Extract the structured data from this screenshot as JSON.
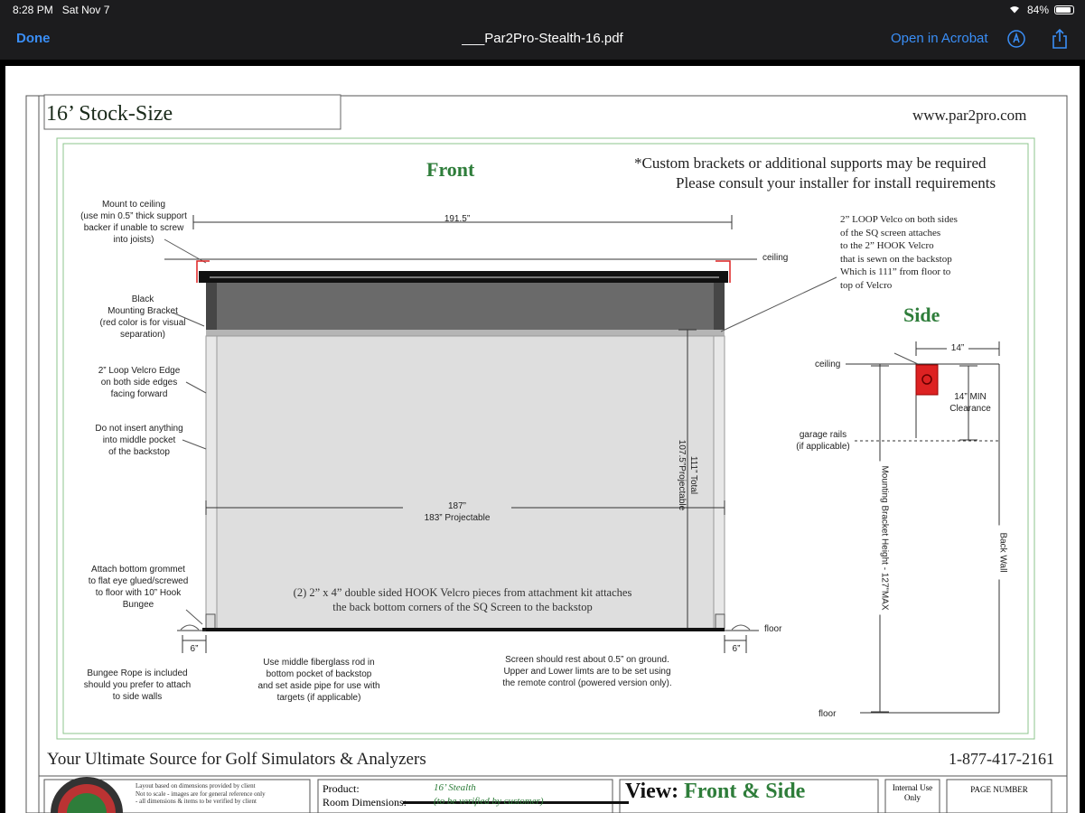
{
  "status": {
    "time": "8:28 PM",
    "date": "Sat Nov 7",
    "battery": "84%"
  },
  "nav": {
    "done": "Done",
    "title": "___Par2Pro-Stealth-16.pdf",
    "open_in": "Open in Acrobat"
  },
  "doc": {
    "heading": "16’ Stock-Size",
    "website": "www.par2pro.com",
    "front_title": "Front",
    "custom_note_1": "*Custom brackets or additional supports may be required",
    "custom_note_2": "Please consult your installer for install requirements",
    "front": {
      "mount_note": [
        "Mount to ceiling",
        "(use min 0.5” thick support",
        "backer if unable to screw",
        "into joists)"
      ],
      "dim_width": "191.5”",
      "ceiling": "ceiling",
      "bracket_note": [
        "Black",
        "Mounting Bracket",
        "(red color is for visual",
        "separation)"
      ],
      "velcro_edge_note": [
        "2” Loop Velcro Edge",
        "on both side edges",
        "facing forward"
      ],
      "pocket_note": [
        "Do not insert anything",
        "into middle pocket",
        "of the backstop"
      ],
      "dim_height_total": "111” Total",
      "dim_height_proj": "107.5”Projectable",
      "dim_inner_width": "187”",
      "dim_inner_proj": "183” Projectable",
      "grommet_note": [
        "Attach bottom grommet",
        "to flat eye glued/screwed",
        "to floor with 10” Hook",
        "Bungee"
      ],
      "hook_note": [
        "(2) 2” x 4” double sided HOOK Velcro pieces from attachment kit attaches",
        "the back bottom corners of the SQ Screen to the backstop"
      ],
      "floor": "floor",
      "dim_left": "6”",
      "dim_right": "6”",
      "bungee_note": [
        "Bungee Rope is included",
        "should you prefer to attach",
        "to side walls"
      ],
      "rod_note": [
        "Use middle fiberglass rod in",
        "bottom pocket of backstop",
        "and set aside pipe for use with",
        "targets (if applicable)"
      ],
      "rest_note": [
        "Screen should rest about 0.5” on ground.",
        "Upper and Lower limts are to be set using",
        "the remote control (powered version only)."
      ]
    },
    "loop_note": [
      "2” LOOP Velco on both sides",
      "of the SQ screen attaches",
      "to the 2” HOOK Velcro",
      "that is sewn on the backstop",
      "Which is 111” from floor to",
      "top of Velcro"
    ],
    "side": {
      "title": "Side",
      "dim_top": "14”",
      "ceiling": "ceiling",
      "clearance": [
        "14” MIN",
        "Clearance"
      ],
      "garage": [
        "garage rails",
        "(if applicable)"
      ],
      "height": "Mounting Bracket Height - 127”MAX",
      "back_wall": "Back Wall",
      "floor": "floor"
    },
    "footer_tagline": "Your Ultimate Source for Golf Simulators & Analyzers",
    "phone": "1-877-417-2161",
    "info": {
      "layout_note": [
        "Layout based on dimensions provided by client",
        "Not to scale - images are for general reference only",
        "- all dimensions & items to be verified by client"
      ],
      "product_label": "Product:",
      "product_value": "16’ Stealth",
      "room_label": "Room Dimensions:",
      "room_value": "(to be verified by customer)",
      "view_label": "View:",
      "view_value": "Front & Side",
      "internal": [
        "Internal Use",
        "Only"
      ],
      "page_number": "PAGE NUMBER"
    }
  },
  "colors": {
    "accent": "#3a8ef6",
    "green": "#2e7d3a",
    "red": "#d22"
  }
}
